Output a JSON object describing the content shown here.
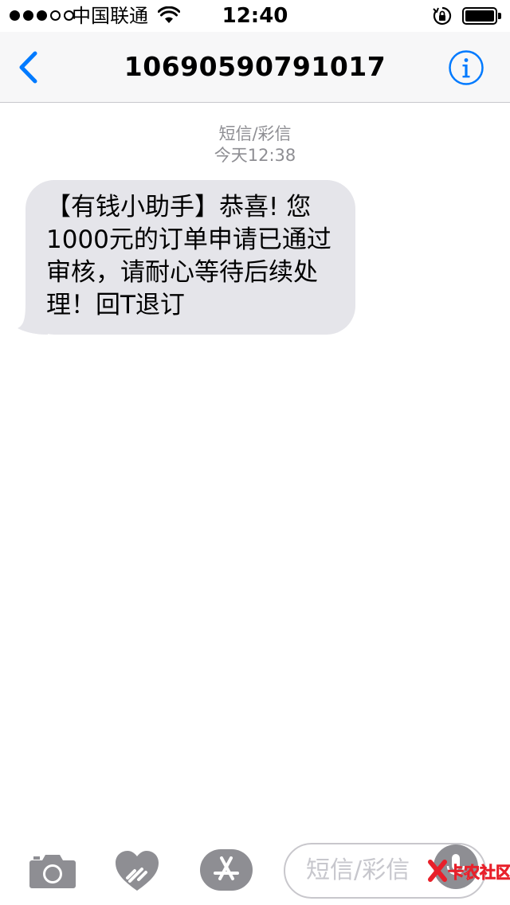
{
  "status_bar": {
    "carrier": "中国联通",
    "time": "12:40",
    "signal_bars_filled": 3,
    "signal_bars_total": 5,
    "battery_level": 1.0
  },
  "nav": {
    "back_icon": "chevron-left-icon",
    "title": "10690590791017",
    "info_icon": "info-icon"
  },
  "thread": {
    "service_label": "短信/彩信",
    "timestamp": "今天12:38",
    "messages": [
      {
        "direction": "incoming",
        "text": "【有钱小助手】恭喜! 您1000元的订单申请已通过审核，请耐心等待后续处理！回T退订"
      }
    ]
  },
  "input_bar": {
    "camera_icon": "camera-icon",
    "digital_touch_icon": "heart-icon",
    "apps_icon": "app-store-icon",
    "placeholder": "短信/彩信",
    "mic_icon": "microphone-icon"
  },
  "watermark": {
    "text": "卡农社区"
  },
  "colors": {
    "accent": "#007aff",
    "bubble_incoming": "#e5e5ea",
    "meta_text": "#8e8e93",
    "nav_background": "#f7f7f8",
    "watermark": "#e8202a"
  }
}
